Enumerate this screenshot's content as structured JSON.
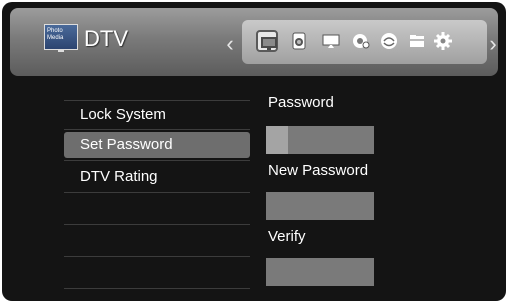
{
  "header": {
    "app_icon_text": "Photo Media",
    "title": "DTV",
    "menu_icons": [
      {
        "name": "tv-icon",
        "selected": true
      },
      {
        "name": "speaker-icon",
        "selected": false
      },
      {
        "name": "monitor-icon",
        "selected": false
      },
      {
        "name": "globe-settings-icon",
        "selected": false
      },
      {
        "name": "network-icon",
        "selected": false
      },
      {
        "name": "folder-icon",
        "selected": false
      },
      {
        "name": "gear-icon",
        "selected": false
      }
    ]
  },
  "menu": {
    "items": [
      {
        "label": "Lock System",
        "selected": false
      },
      {
        "label": "Set Password",
        "selected": true
      },
      {
        "label": "DTV Rating",
        "selected": false
      }
    ]
  },
  "password_form": {
    "password_label": "Password",
    "new_password_label": "New Password",
    "verify_label": "Verify",
    "password_value": "",
    "new_password_value": "",
    "verify_value": ""
  },
  "colors": {
    "background": "#141414",
    "selected_item": "#6e6e6e",
    "input_field": "#7a7a7a",
    "text": "#ffffff"
  }
}
